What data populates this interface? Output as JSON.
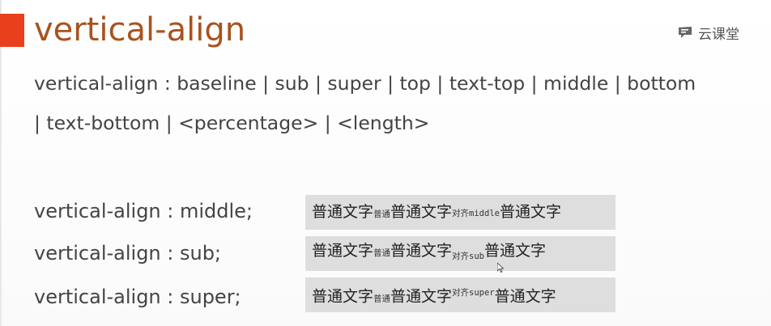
{
  "title": "vertical-align",
  "logo": {
    "text": "云课堂",
    "icon": "screen-logo-icon"
  },
  "syntax": {
    "line1": "vertical-align : baseline | sub | super | top | text-top | middle | bottom",
    "line2": "| text-bottom | <percentage> | <length>"
  },
  "colors": {
    "accent": "#e8401c",
    "title": "#a8531d",
    "demo_bg": "#dedede"
  },
  "examples": [
    {
      "label": "vertical-align : middle;",
      "text_before": "普通文字",
      "text_small": "普通",
      "text_mid": "普通文字",
      "aligned_cjk": "对齐",
      "aligned_code": "middle",
      "text_after": "普通文字"
    },
    {
      "label": "vertical-align : sub;",
      "text_before": "普通文字",
      "text_small": "普通",
      "text_mid": "普通文字",
      "aligned_cjk": "对齐",
      "aligned_code": "sub",
      "text_after": "普通文字"
    },
    {
      "label": "vertical-align : super;",
      "text_before": "普通文字",
      "text_small": "普通",
      "text_mid": "普通文字",
      "aligned_cjk": "对齐",
      "aligned_code": "super",
      "text_after": "普通文字"
    }
  ]
}
